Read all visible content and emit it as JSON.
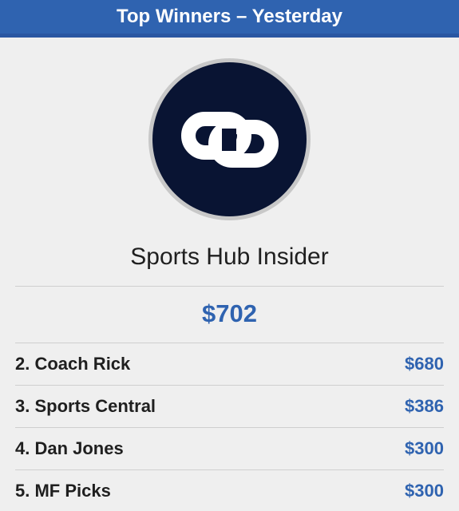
{
  "header": {
    "title": "Top Winners – Yesterday"
  },
  "featured": {
    "logo": "Sports Hub Insider logo",
    "name": "Sports Hub Insider",
    "amount": "$702"
  },
  "rankings": [
    {
      "label": "2. Coach Rick",
      "amount": "$680"
    },
    {
      "label": "3. Sports Central",
      "amount": "$386"
    },
    {
      "label": "4. Dan Jones",
      "amount": "$300"
    },
    {
      "label": "5. MF Picks",
      "amount": "$300"
    }
  ],
  "colors": {
    "header": "#2f63b0",
    "accent": "#2f63b0",
    "logo_background": "#091433",
    "page_background": "#efefef"
  }
}
